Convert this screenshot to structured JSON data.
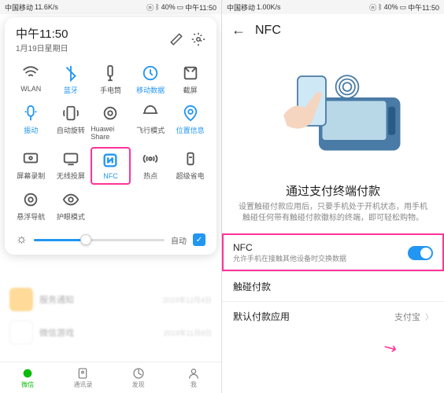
{
  "left": {
    "status": {
      "carrier": "中国移动",
      "net": "11.6K/s",
      "battery": "40%",
      "time": "中午11:50"
    },
    "panel": {
      "time": "中午11:50",
      "date": "1月19日星期日",
      "tiles": [
        {
          "label": "WLAN"
        },
        {
          "label": "蓝牙",
          "active": true
        },
        {
          "label": "手电筒"
        },
        {
          "label": "移动数据",
          "active": true
        },
        {
          "label": "截屏"
        },
        {
          "label": "振动",
          "active": true
        },
        {
          "label": "自动旋转"
        },
        {
          "label": "Huawei Share"
        },
        {
          "label": "飞行模式"
        },
        {
          "label": "位置信息",
          "active": true
        },
        {
          "label": "屏幕录制"
        },
        {
          "label": "无线投屏"
        },
        {
          "label": "NFC",
          "active": true,
          "highlight": true
        },
        {
          "label": "热点"
        },
        {
          "label": "超级省电"
        },
        {
          "label": "悬浮导航"
        },
        {
          "label": "护眼模式"
        }
      ],
      "auto_label": "自动"
    },
    "blurred": [
      {
        "title": "服务通知",
        "sub": "",
        "date": "2019年12月4日"
      },
      {
        "title": "微信游戏",
        "sub": "",
        "date": "2019年11月8日"
      }
    ],
    "nav": [
      {
        "label": "微信",
        "active": true
      },
      {
        "label": "通讯录"
      },
      {
        "label": "发现"
      },
      {
        "label": "我"
      }
    ]
  },
  "right": {
    "status": {
      "carrier": "中国移动",
      "net": "1.00K/s",
      "battery": "40%",
      "time": "中午11:50"
    },
    "header_title": "NFC",
    "section_title": "通过支付终端付款",
    "section_desc": "设置触碰付款应用后，只要手机处于开机状态，用手机触碰任何带有触碰付款徽标的终端，即可轻松购物。",
    "rows": {
      "nfc": {
        "title": "NFC",
        "sub": "允许手机在接触其他设备时交换数据"
      },
      "tap_pay": {
        "title": "触碰付款"
      },
      "default_app": {
        "title": "默认付款应用",
        "value": "支付宝"
      }
    }
  }
}
